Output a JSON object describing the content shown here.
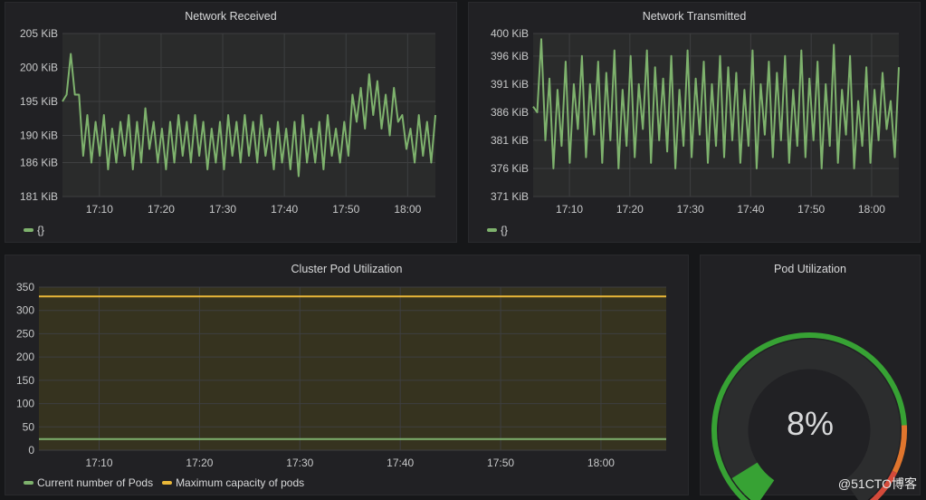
{
  "panels": {
    "network_received": {
      "title": "Network Received",
      "legend": [
        {
          "label": "{}",
          "color": "#7eb26d"
        }
      ]
    },
    "network_transmitted": {
      "title": "Network Transmitted",
      "legend": [
        {
          "label": "{}",
          "color": "#7eb26d"
        }
      ]
    },
    "cluster_pod": {
      "title": "Cluster Pod Utilization",
      "legend": [
        {
          "label": "Current number of Pods",
          "color": "#7eb26d"
        },
        {
          "label": "Maximum capacity of pods",
          "color": "#eab839"
        }
      ]
    },
    "pod_util": {
      "title": "Pod Utilization",
      "value_text": "8%",
      "value": 8,
      "thresholds": [
        {
          "color": "#37a234",
          "to": 80
        },
        {
          "color": "#e0752d",
          "to": 90
        },
        {
          "color": "#d44a3a",
          "to": 100
        }
      ]
    }
  },
  "watermark": "@51CTO博客",
  "chart_data": [
    {
      "type": "line",
      "title": "Network Received",
      "x_ticks": [
        "17:10",
        "17:20",
        "17:30",
        "17:40",
        "17:50",
        "18:00"
      ],
      "y_ticks": [
        "181 KiB",
        "186 KiB",
        "190 KiB",
        "195 KiB",
        "200 KiB",
        "205 KiB"
      ],
      "ylim": [
        181,
        205
      ],
      "xlim_minutes": [
        1024,
        1084.5
      ],
      "series": [
        {
          "name": "{}",
          "color": "#7eb26d",
          "values": [
            195,
            196,
            202,
            196,
            196,
            187,
            193,
            186,
            192,
            187,
            193,
            185,
            191,
            186,
            192,
            187,
            193,
            185,
            192,
            186,
            194,
            188,
            192,
            186,
            191,
            185,
            192,
            186,
            193,
            187,
            192,
            186,
            193,
            187,
            192,
            185,
            191,
            186,
            192,
            185,
            193,
            187,
            192,
            186,
            193,
            187,
            192,
            186,
            193,
            187,
            191,
            185,
            192,
            186,
            191,
            185,
            192,
            184,
            193,
            186,
            191,
            186,
            192,
            185,
            193,
            187,
            191,
            186,
            192,
            187,
            196,
            192,
            197,
            191,
            199,
            193,
            198,
            191,
            196,
            190,
            197,
            192,
            193,
            188,
            191,
            186,
            193,
            187,
            192,
            186,
            193
          ]
        }
      ]
    },
    {
      "type": "line",
      "title": "Network Transmitted",
      "x_ticks": [
        "17:10",
        "17:20",
        "17:30",
        "17:40",
        "17:50",
        "18:00"
      ],
      "y_ticks": [
        "371 KiB",
        "376 KiB",
        "381 KiB",
        "386 KiB",
        "391 KiB",
        "396 KiB",
        "400 KiB"
      ],
      "ylim": [
        371,
        400
      ],
      "xlim_minutes": [
        1024,
        1084.5
      ],
      "series": [
        {
          "name": "{}",
          "color": "#7eb26d",
          "values": [
            387,
            386,
            399,
            381,
            392,
            376,
            390,
            380,
            395,
            377,
            391,
            383,
            396,
            378,
            391,
            382,
            395,
            377,
            393,
            381,
            397,
            376,
            390,
            380,
            396,
            378,
            391,
            383,
            397,
            377,
            394,
            381,
            392,
            379,
            396,
            376,
            390,
            380,
            397,
            378,
            392,
            382,
            395,
            377,
            391,
            380,
            396,
            378,
            394,
            381,
            393,
            377,
            390,
            380,
            397,
            376,
            391,
            382,
            395,
            378,
            393,
            381,
            396,
            377,
            390,
            380,
            397,
            378,
            392,
            381,
            395,
            376,
            391,
            380,
            398,
            377,
            390,
            382,
            396,
            376,
            388,
            380,
            394,
            377,
            390,
            381,
            393,
            383,
            388,
            378,
            394
          ]
        }
      ]
    },
    {
      "type": "line",
      "title": "Cluster Pod Utilization",
      "x_ticks": [
        "17:10",
        "17:20",
        "17:30",
        "17:40",
        "17:50",
        "18:00"
      ],
      "y_ticks": [
        "0",
        "50",
        "100",
        "150",
        "200",
        "250",
        "300",
        "350"
      ],
      "ylim": [
        0,
        350
      ],
      "xlim_minutes": [
        1024,
        1086.5
      ],
      "series": [
        {
          "name": "Current number of Pods",
          "color": "#7eb26d",
          "values": [
            24,
            24
          ]
        },
        {
          "name": "Maximum capacity of pods",
          "color": "#eab839",
          "values": [
            330,
            330
          ]
        }
      ]
    }
  ]
}
